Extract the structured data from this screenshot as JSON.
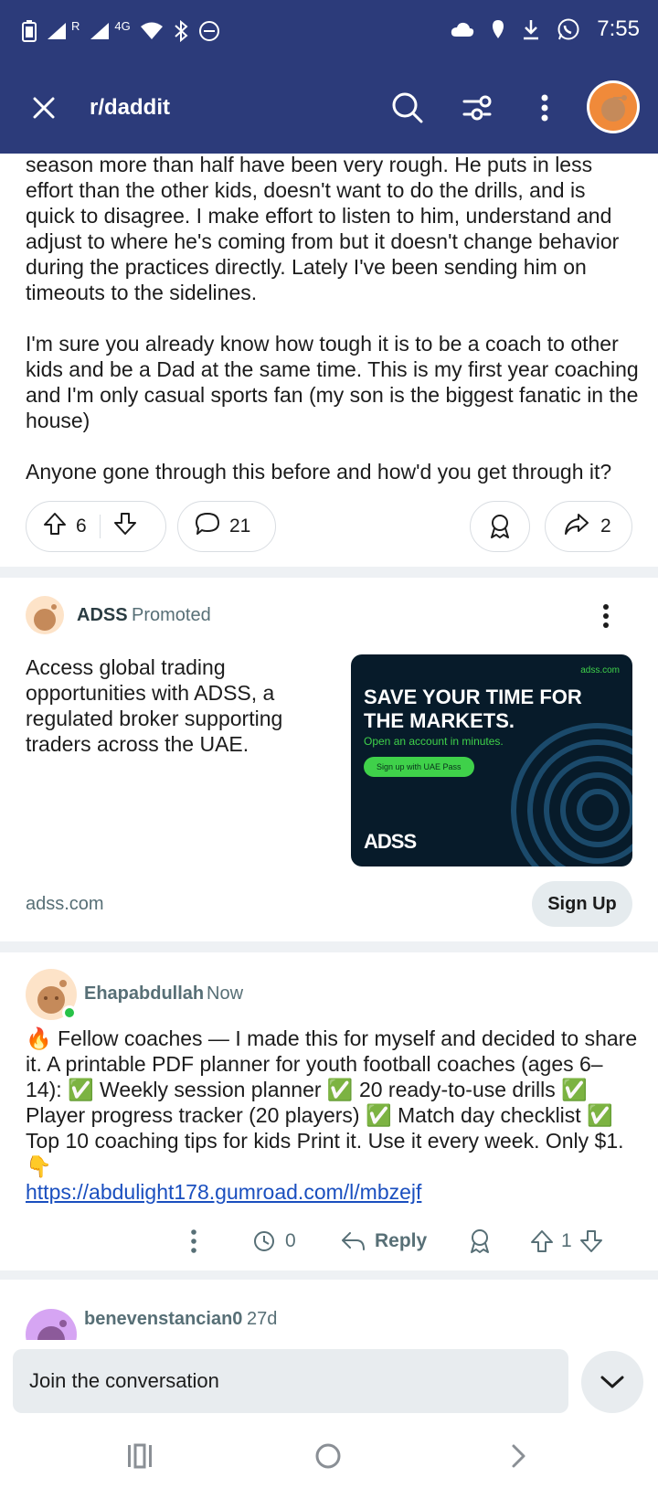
{
  "status_bar": {
    "time": "7:55",
    "network": "4G",
    "carrier_tag": "R"
  },
  "header": {
    "title": "r/daddit"
  },
  "post": {
    "paragraphs": [
      "season more than half have been very rough. He puts in less effort than the other kids, doesn't want to do the drills, and is quick to disagree. I make effort to listen to him, understand and adjust to where he's coming from but it doesn't change behavior during the practices directly. Lately I've been sending him on timeouts to the sidelines.",
      "I'm sure you already know how tough it is to be a coach to other kids and be a Dad at the same time. This is my first year coaching and I'm only casual sports fan (my son is the biggest fanatic in the house)",
      "Anyone gone through this before and how'd you get through it?"
    ],
    "upvotes": "6",
    "comments": "21",
    "shares": "2"
  },
  "ad": {
    "author": "ADSS",
    "label": "Promoted",
    "text": "Access global trading opportunities with ADSS, a regulated broker supporting traders across the UAE.",
    "image_url_text": "adss.com",
    "image_headline": "SAVE YOUR TIME FOR THE MARKETS.",
    "image_subline": "Open an account in minutes.",
    "image_cta": "Sign up with UAE Pass",
    "image_logo": "ADSS",
    "domain": "adss.com",
    "cta": "Sign Up"
  },
  "comment": {
    "author": "Ehapabdullah",
    "time": "Now",
    "body": "🔥 Fellow coaches — I made this for myself and decided to share it. A printable PDF planner for youth football coaches (ages 6–14): ✅ Weekly session planner ✅ 20 ready-to-use drills ✅ Player progress tracker (20 players) ✅ Match day checklist ✅ Top 10 coaching tips for kids Print it. Use it every week. Only $1. 👇",
    "link": "https://abdulight178.gumroad.com/l/mbzejf",
    "timer_count": "0",
    "reply_label": "Reply",
    "votes": "1"
  },
  "comment2": {
    "author": "benevenstancian0",
    "time": "27d"
  },
  "join": {
    "placeholder": "Join the conversation"
  },
  "colors": {
    "header_bg": "#2c3b7a",
    "link": "#1a4fbf",
    "ad_green": "#3fd14a",
    "online": "#27c247"
  }
}
